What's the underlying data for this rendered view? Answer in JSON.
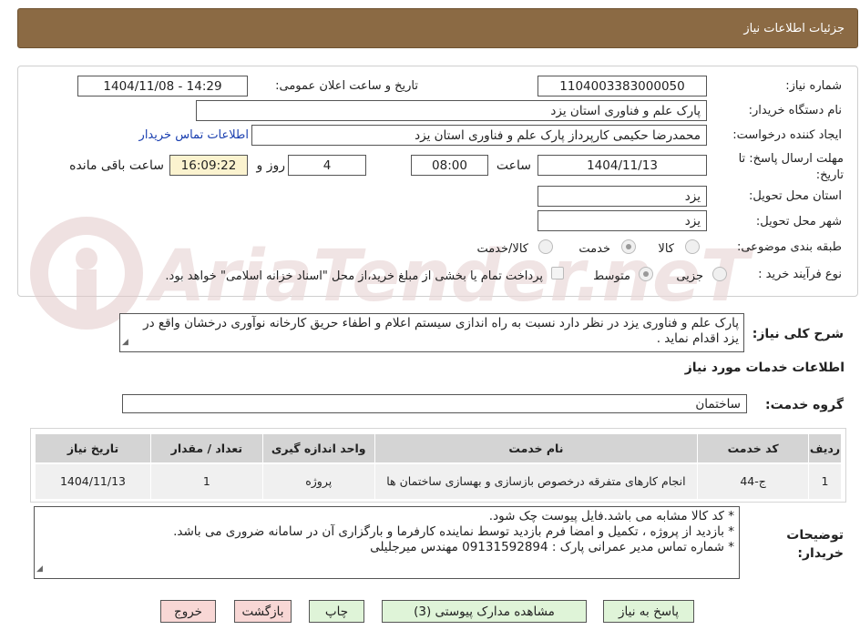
{
  "header": {
    "title": "جزئيات اطلاعات نياز"
  },
  "form": {
    "need_number_label": "شماره نیاز:",
    "need_number": "1104003383000050",
    "announce_label": "تاریخ و ساعت اعلان عمومی:",
    "announce_value": "1404/11/08 - 14:29",
    "buyer_org_label": "نام دستگاه خریدار:",
    "buyer_org": "پارک علم و فناوری استان یزد",
    "requester_label": "ایجاد کننده درخواست:",
    "requester": "محمدرضا  حکیمی کارپرداز پارک علم و فناوری استان یزد",
    "contact_link": "اطلاعات تماس خریدار",
    "deadline_label": "مهلت ارسال پاسخ: تا تاریخ:",
    "deadline_date": "1404/11/13",
    "time_label": "ساعت",
    "deadline_time": "08:00",
    "days_value": "4",
    "days_label": "روز و",
    "remaining_time": "16:09:22",
    "remaining_label": "ساعت باقی مانده",
    "province_label": "استان محل تحویل:",
    "province": "یزد",
    "city_label": "شهر محل تحویل:",
    "city": "یزد",
    "category_label": "طبقه بندی موضوعی:",
    "category_options": [
      "کالا",
      "خدمت",
      "کالا/خدمت"
    ],
    "category_selected": "خدمت",
    "process_label": "نوع فرآیند خرید :",
    "process_options": [
      "جزیی",
      "متوسط"
    ],
    "process_selected": "متوسط",
    "payment_note": "پرداخت تمام یا بخشی از مبلغ خرید،از محل \"اسناد خزانه اسلامی\" خواهد بود."
  },
  "description": {
    "label": "شرح کلی نیاز:",
    "text": "پارک علم و فناوری یزد در نظر دارد نسبت به راه اندازی سیستم اعلام و اطفاء حریق کارخانه نوآوری درخشان واقع در یزد اقدام نماید ."
  },
  "services_section": {
    "title": "اطلاعات خدمات مورد نیاز",
    "group_label": "گروه خدمت:",
    "group_value": "ساختمان"
  },
  "table": {
    "headers": [
      "ردیف",
      "کد خدمت",
      "نام خدمت",
      "واحد اندازه گیری",
      "تعداد / مقدار",
      "تاریخ نیاز"
    ],
    "rows": [
      [
        "1",
        "ج-44",
        "انجام کارهای متفرقه درخصوص بازسازی و بهسازی ساختمان ها",
        "پروژه",
        "1",
        "1404/11/13"
      ]
    ]
  },
  "buyer_notes": {
    "label": "توضیحات خریدار:",
    "lines": [
      "* کد کالا مشابه می باشد.فایل پیوست چک شود.",
      "* بازدید از پروژه ، تکمیل و امضا  فرم بازدید توسط نماینده کارفرما و بارگزاری آن در سامانه ضروری می باشد.",
      "* شماره تماس مدیر عمرانی پارک  :  09131592894 مهندس میرجلیلی"
    ]
  },
  "buttons": {
    "reply": "پاسخ به نیاز",
    "attachments": "مشاهده مدارک پیوستی (3)",
    "print": "چاپ",
    "back": "بازگشت",
    "exit": "خروج"
  },
  "watermark": {
    "text": "AriaTender.neT",
    "color": "#e8d6d6"
  },
  "colors": {
    "header": "#8b6a44",
    "button_green": "#dff4d8",
    "button_red": "#f8d7d5",
    "link": "#1a3fb0"
  }
}
